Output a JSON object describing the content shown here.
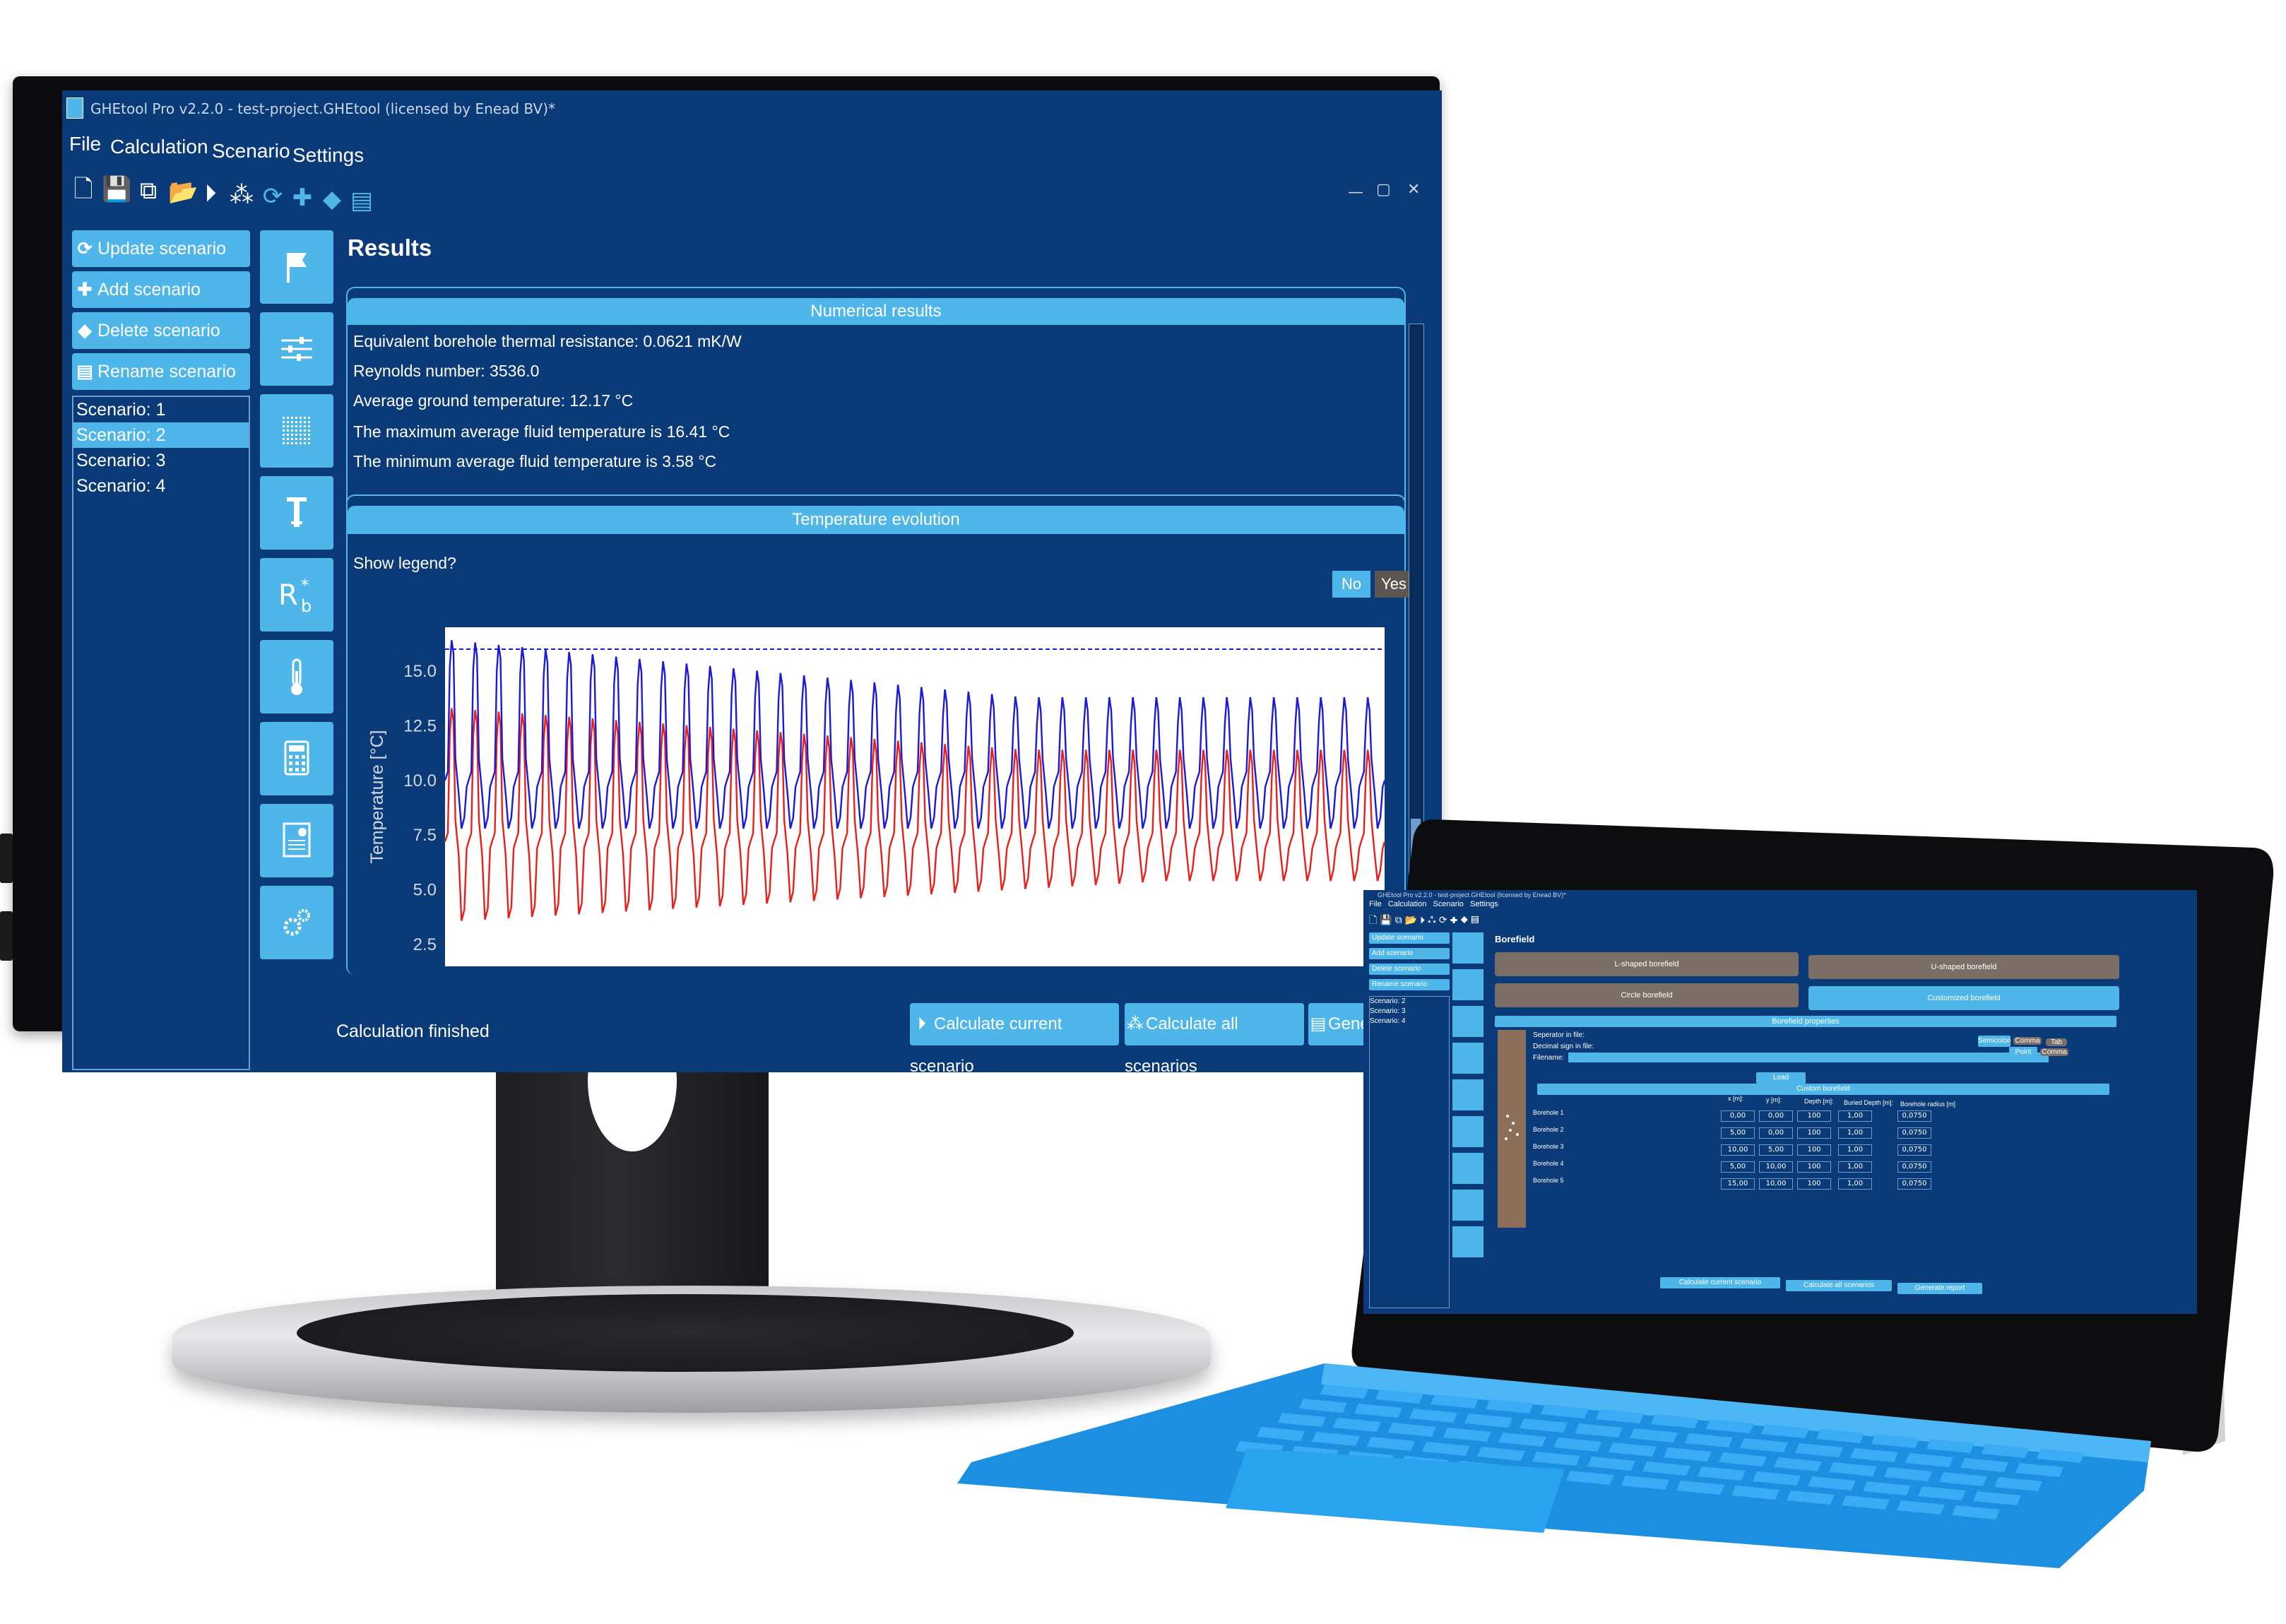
{
  "monitor": {
    "window_title": "GHEtool Pro v2.2.0  -  test-project.GHEtool (licensed by Enead BV)*",
    "menu": [
      "File",
      "Calculation",
      "Scenario",
      "Settings"
    ],
    "window_controls": {
      "minimize": "—",
      "maximize": "▢",
      "close": "✕"
    },
    "toolbar_icons": [
      "new-file-icon",
      "save-icon",
      "save-as-icon",
      "open-folder-icon",
      "play-icon",
      "network-icon",
      "refresh-icon",
      "plus-icon",
      "eraser-icon",
      "rename-icon"
    ],
    "sidebar": {
      "buttons": [
        {
          "label": "Update scenario",
          "icon": "refresh-icon"
        },
        {
          "label": "Add scenario",
          "icon": "plus-icon"
        },
        {
          "label": "Delete scenario",
          "icon": "eraser-icon"
        },
        {
          "label": "Rename scenario",
          "icon": "rename-icon"
        }
      ],
      "scenarios": [
        "Scenario: 1",
        "Scenario: 2",
        "Scenario: 3",
        "Scenario: 4"
      ],
      "selected": "Scenario: 2"
    },
    "nav_icons": [
      "flag-icon",
      "sliders-icon",
      "grid-icon",
      "borehole-icon",
      "rb-icon",
      "thermometer-icon",
      "calculator-icon",
      "report-icon",
      "settings-icon"
    ],
    "rb_label": "R",
    "rb_sub": "b",
    "rb_sup": "*",
    "results": {
      "title": "Results",
      "numerical_header": "Numerical results",
      "lines": [
        "Equivalent borehole thermal resistance: 0.0621 mK/W",
        "Reynolds number: 3536.0",
        "Average ground temperature: 12.17 °C",
        "The maximum average fluid temperature is 16.41 °C",
        "The minimum average fluid temperature is 3.58 °C"
      ],
      "temp_header": "Temperature evolution",
      "legend_question": "Show legend?",
      "toggle_no": "No",
      "toggle_yes": "Yes"
    },
    "bottom_buttons": {
      "calc_current": "Calculate current scenario",
      "calc_all": "Calculate all scenarios",
      "report": "Generate report"
    },
    "status": "Calculation finished",
    "colors": {
      "bg": "#0b3a78",
      "accent": "#4fb6ea",
      "blue_series": "#1a1adb",
      "red_series": "#e8201c",
      "limit": "#1a1adb"
    }
  },
  "chart_data": {
    "type": "line",
    "ylabel": "Temperature [°C]",
    "xlabel": "",
    "yticks": [
      2.5,
      5.0,
      7.5,
      10.0,
      12.5,
      15.0
    ],
    "ytick_labels": [
      "2.5",
      "5.0",
      "7.5",
      "10.0",
      "12.5",
      "15.0"
    ],
    "ylim": [
      1.5,
      17.0
    ],
    "max_limit_line": 16.0,
    "years": 40,
    "series": [
      {
        "color": "#1a1adb",
        "peak_max": 16.41,
        "peak_end": 13.8,
        "base": 10.0,
        "trough": 7.8
      },
      {
        "color": "#e8201c",
        "peak_max": 13.3,
        "peak_end": 11.4,
        "base": 7.2,
        "trough_min": 3.58,
        "trough_end": 5.4
      }
    ]
  },
  "tablet": {
    "window_title": "GHEtool Pro v2.2.0  -  test-project.GHEtool (licensed by Enead BV)*",
    "menu": [
      "File",
      "Calculation",
      "Scenario",
      "Settings"
    ],
    "sidebar_buttons": [
      "Update scenario",
      "Add scenario",
      "Delete scenario",
      "Rename scenario"
    ],
    "scenarios": [
      "Scenario: 2",
      "Scenario: 3",
      "Scenario: 4"
    ],
    "page_title": "Borefield",
    "shapes": [
      "L-shaped borefield",
      "U-shaped borefield",
      "Circle borefield",
      "Customized borefield"
    ],
    "props_header": "Borefield properties",
    "separator_label": "Seperator in file:",
    "decimal_label": "Decimal sign in file:",
    "filename_label": "Filename:",
    "sep_options": [
      "Semicolon",
      "Comma",
      "Tab"
    ],
    "dec_options": [
      "Point",
      "Comma"
    ],
    "load_label": "Load",
    "custom_header": "Custom borefield",
    "columns": [
      "x [m]:",
      "y [m]:",
      "Depth [m]:",
      "Buried Depth [m]:",
      "Borehole radius [m]"
    ],
    "rows": [
      {
        "label": "Borehole 1",
        "x": "0,00",
        "y": "0,00",
        "depth": "100",
        "buried": "1,00",
        "radius": "0,0750"
      },
      {
        "label": "Borehole 2",
        "x": "5,00",
        "y": "0,00",
        "depth": "100",
        "buried": "1,00",
        "radius": "0,0750"
      },
      {
        "label": "Borehole 3",
        "x": "10,00",
        "y": "5,00",
        "depth": "100",
        "buried": "1,00",
        "radius": "0,0750"
      },
      {
        "label": "Borehole 4",
        "x": "5,00",
        "y": "10,00",
        "depth": "100",
        "buried": "1,00",
        "radius": "0,0750"
      },
      {
        "label": "Borehole 5",
        "x": "15,00",
        "y": "10,00",
        "depth": "100",
        "buried": "1,00",
        "radius": "0,0750"
      }
    ],
    "bottom_buttons": [
      "Calculate current scenario",
      "Calculate all scenarios",
      "Generate report"
    ]
  }
}
